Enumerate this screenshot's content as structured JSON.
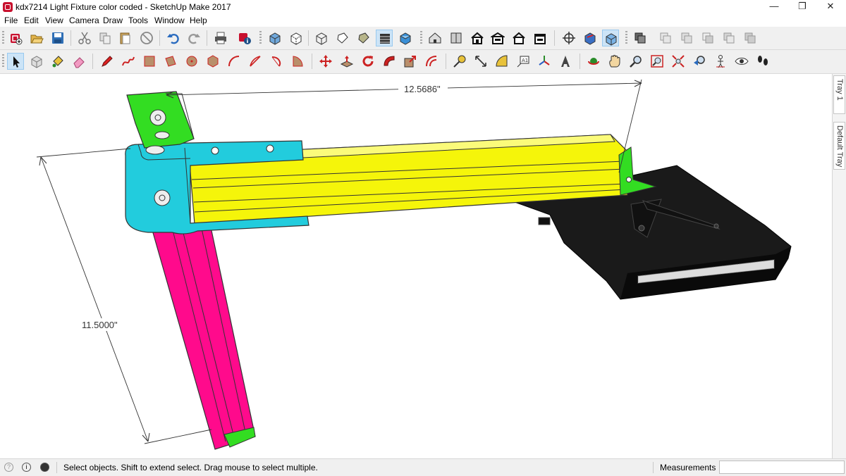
{
  "window": {
    "title": "kdx7214 Light Fixture color coded - SketchUp Make 2017",
    "controls": {
      "minimize": "—",
      "maximize": "❐",
      "close": "✕"
    }
  },
  "menu": [
    "File",
    "Edit",
    "View",
    "Camera",
    "Draw",
    "Tools",
    "Window",
    "Help"
  ],
  "toolbar_top": {
    "icons": [
      "new-icon",
      "open-icon",
      "save-icon",
      "cut-icon",
      "copy-icon",
      "paste-icon",
      "erase-icon",
      "undo-icon",
      "redo-icon",
      "print-icon",
      "model-info-icon",
      "xray-icon",
      "back-edges-icon",
      "wireframe-icon",
      "hidden-line-icon",
      "shaded-icon",
      "shaded-textures-icon",
      "monochrome-icon",
      "iso-view-icon",
      "top-view-icon",
      "front-view-icon",
      "right-view-icon",
      "back-view-icon",
      "left-view-icon",
      "section-plane-icon",
      "display-section-planes-icon",
      "display-section-cuts-icon",
      "outer-shell-icon",
      "intersect-icon",
      "union-icon",
      "subtract-icon",
      "trim-icon",
      "split-icon"
    ]
  },
  "toolbar_bottom": {
    "icons": [
      "select-icon",
      "make-component-icon",
      "paint-bucket-icon",
      "eraser-icon",
      "pencil-icon",
      "freehand-icon",
      "rectangle-icon",
      "rotated-rectangle-icon",
      "circle-icon",
      "polygon-icon",
      "arc-icon",
      "two-point-arc-icon",
      "three-point-arc-icon",
      "pie-icon",
      "move-icon",
      "push-pull-icon",
      "rotate-icon",
      "follow-me-icon",
      "scale-icon",
      "offset-icon",
      "tape-measure-icon",
      "dimension-icon",
      "protractor-icon",
      "text-icon",
      "axes-icon",
      "3d-text-icon",
      "orbit-icon",
      "pan-icon",
      "zoom-icon",
      "zoom-window-icon",
      "zoom-extents-icon",
      "previous-view-icon",
      "position-camera-icon",
      "look-around-icon",
      "walk-icon"
    ]
  },
  "model": {
    "dimension_horizontal": "12.5686\"",
    "dimension_vertical": "11.5000\"",
    "colors": {
      "green": "#33dd22",
      "cyan": "#22ccdd",
      "yellow": "#f5f50a",
      "magenta": "#ff0a8c",
      "black": "#111111"
    }
  },
  "tray": {
    "tabs": [
      "Tray 1",
      "Default Tray"
    ]
  },
  "status": {
    "hint": "Select objects. Shift to extend select. Drag mouse to select multiple.",
    "measurements_label": "Measurements",
    "measurements_value": ""
  }
}
